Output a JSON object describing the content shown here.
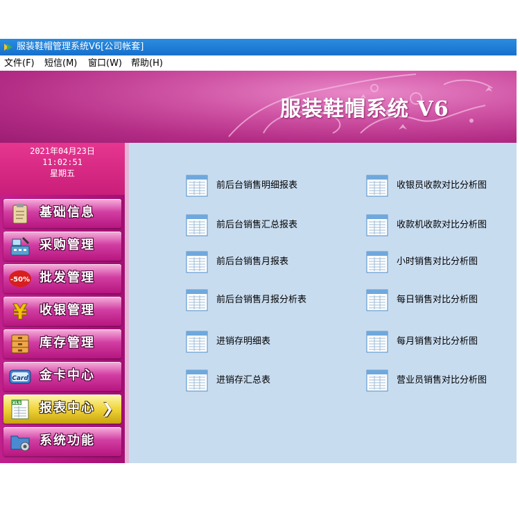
{
  "window": {
    "title": "服装鞋帽管理系统V6[公司帐套]"
  },
  "menu": [
    {
      "label": "文件(F)"
    },
    {
      "label": "短信(M)"
    },
    {
      "label": "窗口(W)"
    },
    {
      "label": "帮助(H)"
    }
  ],
  "banner": {
    "brand": "服装鞋帽系统 V6"
  },
  "clock": {
    "date": "2021年04月23日",
    "time": "11:02:51",
    "weekday": "星期五"
  },
  "nav": [
    {
      "label": "基础信息",
      "icon": "clipboard-icon"
    },
    {
      "label": "采购管理",
      "icon": "cash-register-icon"
    },
    {
      "label": "批发管理",
      "icon": "discount-tag-icon",
      "badge": "-50%"
    },
    {
      "label": "收银管理",
      "icon": "yen-icon",
      "symbol": "¥"
    },
    {
      "label": "库存管理",
      "icon": "drawer-cabinet-icon"
    },
    {
      "label": "金卡中心",
      "icon": "card-icon",
      "card_text": "Card"
    },
    {
      "label": "报表中心",
      "icon": "xls-spreadsheet-icon",
      "badge": "XLS",
      "active": true,
      "chevron": "❯"
    },
    {
      "label": "系统功能",
      "icon": "settings-folder-icon"
    }
  ],
  "reports_left": [
    {
      "label": "前后台销售明细报表"
    },
    {
      "label": "前后台销售汇总报表"
    },
    {
      "label": "前后台销售月报表"
    },
    {
      "label": "前后台销售月报分析表"
    },
    {
      "label": "进销存明细表"
    },
    {
      "label": "进销存汇总表"
    }
  ],
  "reports_right": [
    {
      "label": "收银员收款对比分析图"
    },
    {
      "label": "收款机收款对比分析图"
    },
    {
      "label": "小时销售对比分析图"
    },
    {
      "label": "每日销售对比分析图"
    },
    {
      "label": "每月销售对比分析图"
    },
    {
      "label": "营业员销售对比分析图"
    }
  ],
  "colors": {
    "titlebar": "#1f7fd8",
    "banner": "#c43d96",
    "sidebar": "#b0167c",
    "content": "#c8dcf0",
    "active_nav": "#f0d43a"
  }
}
